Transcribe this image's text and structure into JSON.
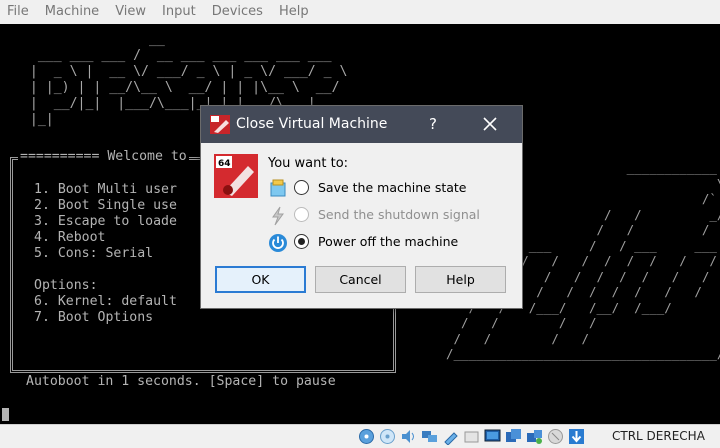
{
  "menubar": {
    "items": [
      "File",
      "Machine",
      "View",
      "Input",
      "Devices",
      "Help"
    ]
  },
  "console": {
    "logo_ascii": "                 __\n   ___ ___ ___ /  __ ___ ___ ___ ___ ___\n  |  _ \\ |  __ \\/ ___/ _ \\ | _ \\/ ___/ _ \\\n  | |_) | | __/\\__ \\  __/ | | |\\__ \\  __/\n  |  __/|_|  |___/\\___|_| |_|___/\\___|\n  |_|",
    "menu_title": "========== Welcome to",
    "menu_items": "1. Boot Multi user\n2. Boot Single use\n3. Escape to loade\n4. Reboot\n5. Cons: Serial\n\nOptions:\n6. Kernel: default\n7. Boot Options",
    "autoboot": "Autoboot in 1 seconds. [Space] to pause",
    "art_ascii": "                        ____________\n                                    \\\n                                  /`  \\\n                     /   /         _/ :-|\n                    /   /         /   /_|\n  _______  ___     /   / ___     ___ / |\n  /   /   /   /   /  /  /  /   /   /\n /   /   /   /   /  /  /  /   /   /\n/   /   /   /   /  /  /  /   /   /\n   /   /   /___/   /__/  /___/\n  /   /        /   /\n /   /        /   /\n/___________________________________/"
  },
  "dialog": {
    "title": "Close Virtual Machine",
    "help_glyph": "?",
    "prompt": "You want to:",
    "options": [
      {
        "label": "Save the machine state",
        "checked": false,
        "enabled": true
      },
      {
        "label": "Send the shutdown signal",
        "checked": false,
        "enabled": false
      },
      {
        "label": "Power off the machine",
        "checked": true,
        "enabled": true
      }
    ],
    "buttons": {
      "ok": "OK",
      "cancel": "Cancel",
      "help": "Help"
    },
    "icon_badge": "64"
  },
  "statusbar": {
    "host_key": "CTRL DERECHA",
    "icons": [
      "hard-disk-icon",
      "optical-drive-icon",
      "audio-icon",
      "network-icon",
      "usb-icon",
      "shared-folder-icon",
      "display-icon",
      "video-capture-icon",
      "recording-icon",
      "mouse-integration-icon",
      "host-key-arrow-icon"
    ]
  },
  "colors": {
    "titlebar": "#444a58",
    "accent": "#2b7bd3",
    "console_text": "#b4b4b4"
  }
}
